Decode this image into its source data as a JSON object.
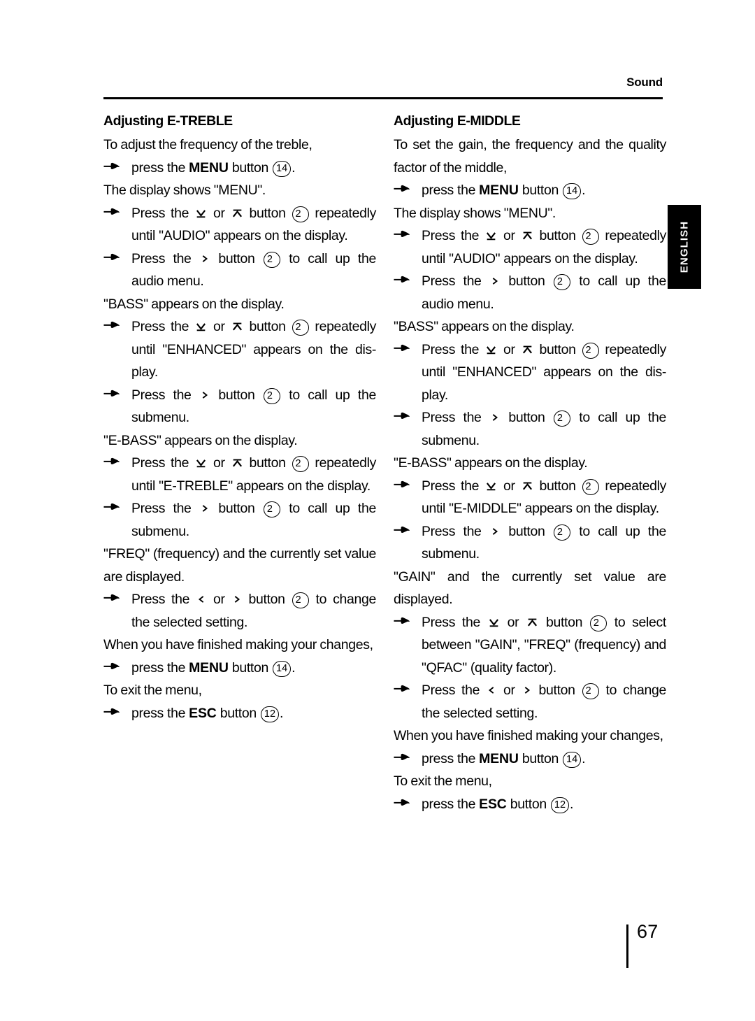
{
  "header": {
    "title": "Sound"
  },
  "side_tab": {
    "label": "ENGLISH"
  },
  "footer": {
    "page_number": "67"
  },
  "icons": {
    "bullet": "pointing-hand",
    "down": "down-arrow-underline",
    "up": "up-arrow-overline",
    "left": "left-chevron",
    "right": "right-chevron"
  },
  "columns": {
    "left": {
      "title": "Adjusting E-TREBLE",
      "blocks": [
        {
          "kind": "para",
          "text": "To adjust the frequency of the treble,"
        },
        {
          "kind": "step",
          "parts": [
            "press the ",
            "MENU",
            " button ",
            "(14)",
            "."
          ]
        },
        {
          "kind": "para",
          "text": "The display shows \"MENU\"."
        },
        {
          "kind": "step",
          "parts": [
            "Press the ",
            "DOWN",
            " or ",
            "UP",
            " button ",
            "(2)",
            " repeatedly until \"AUDIO\" appears on the display."
          ]
        },
        {
          "kind": "step",
          "parts": [
            "Press the ",
            "RIGHT",
            " button ",
            "(2)",
            " to call up the audio menu."
          ]
        },
        {
          "kind": "para",
          "text": "\"BASS\" appears on the display."
        },
        {
          "kind": "step",
          "parts": [
            "Press the ",
            "DOWN",
            " or ",
            "UP",
            " button ",
            "(2)",
            " repeatedly until \"ENHANCED\" appears on the dis-play."
          ]
        },
        {
          "kind": "step",
          "parts": [
            "Press the ",
            "RIGHT",
            " button ",
            "(2)",
            " to call up the submenu."
          ]
        },
        {
          "kind": "para",
          "text": "\"E-BASS\" appears on the display."
        },
        {
          "kind": "step",
          "parts": [
            "Press the ",
            "DOWN",
            " or ",
            "UP",
            " button ",
            "(2)",
            " repeatedly until \"E-TREBLE\" appears on the display."
          ]
        },
        {
          "kind": "step",
          "parts": [
            "Press the ",
            "RIGHT",
            " button ",
            "(2)",
            " to call up the submenu."
          ]
        },
        {
          "kind": "para",
          "text": "\"FREQ\" (frequency) and the currently set value are displayed."
        },
        {
          "kind": "step",
          "parts": [
            "Press the ",
            "LEFT",
            " or ",
            "RIGHT",
            " button ",
            "(2)",
            " to change the selected setting."
          ]
        },
        {
          "kind": "para",
          "text": "When you have finished making your changes,"
        },
        {
          "kind": "step",
          "parts": [
            "press the ",
            "MENU",
            " button ",
            "(14)",
            "."
          ]
        },
        {
          "kind": "para",
          "text": "To exit the menu,"
        },
        {
          "kind": "step",
          "parts": [
            "press the ",
            "ESC",
            " button ",
            "(12)",
            "."
          ]
        }
      ]
    },
    "right": {
      "title": "Adjusting E-MIDDLE",
      "blocks": [
        {
          "kind": "para",
          "text": "To set the gain, the frequency and the quality factor of the middle,"
        },
        {
          "kind": "step",
          "parts": [
            "press the ",
            "MENU",
            " button ",
            "(14)",
            "."
          ]
        },
        {
          "kind": "para",
          "text": "The display shows \"MENU\"."
        },
        {
          "kind": "step",
          "parts": [
            "Press the ",
            "DOWN",
            " or ",
            "UP",
            " button ",
            "(2)",
            " repeatedly until \"AUDIO\" appears on the display."
          ]
        },
        {
          "kind": "step",
          "parts": [
            "Press the ",
            "RIGHT",
            " button ",
            "(2)",
            " to call up the audio menu."
          ]
        },
        {
          "kind": "para",
          "text": "\"BASS\" appears on the display."
        },
        {
          "kind": "step",
          "parts": [
            "Press the ",
            "DOWN",
            " or ",
            "UP",
            " button ",
            "(2)",
            " repeatedly until \"ENHANCED\" appears on the dis-play."
          ]
        },
        {
          "kind": "step",
          "parts": [
            "Press the ",
            "RIGHT",
            " button ",
            "(2)",
            " to call up the submenu."
          ]
        },
        {
          "kind": "para",
          "text": "\"E-BASS\" appears on the display."
        },
        {
          "kind": "step",
          "parts": [
            "Press the ",
            "DOWN",
            " or ",
            "UP",
            " button ",
            "(2)",
            " repeatedly until \"E-MIDDLE\" appears on the display."
          ]
        },
        {
          "kind": "step",
          "parts": [
            "Press the ",
            "RIGHT",
            " button ",
            "(2)",
            " to call up the submenu."
          ]
        },
        {
          "kind": "para",
          "text": "\"GAIN\" and the currently set value are displayed."
        },
        {
          "kind": "step",
          "parts": [
            "Press the ",
            "DOWN",
            " or ",
            "UP",
            " button ",
            "(2)",
            " to select between \"GAIN\", \"FREQ\" (frequency) and \"QFAC\" (quality factor)."
          ]
        },
        {
          "kind": "step",
          "parts": [
            "Press the ",
            "LEFT",
            " or ",
            "RIGHT",
            " button ",
            "(2)",
            " to change the selected setting."
          ]
        },
        {
          "kind": "para",
          "text": "When you have finished making your changes,"
        },
        {
          "kind": "step",
          "parts": [
            "press the ",
            "MENU",
            " button ",
            "(14)",
            "."
          ]
        },
        {
          "kind": "para",
          "text": "To exit the menu,"
        },
        {
          "kind": "step",
          "parts": [
            "press the ",
            "ESC",
            " button ",
            "(12)",
            "."
          ]
        }
      ]
    }
  }
}
